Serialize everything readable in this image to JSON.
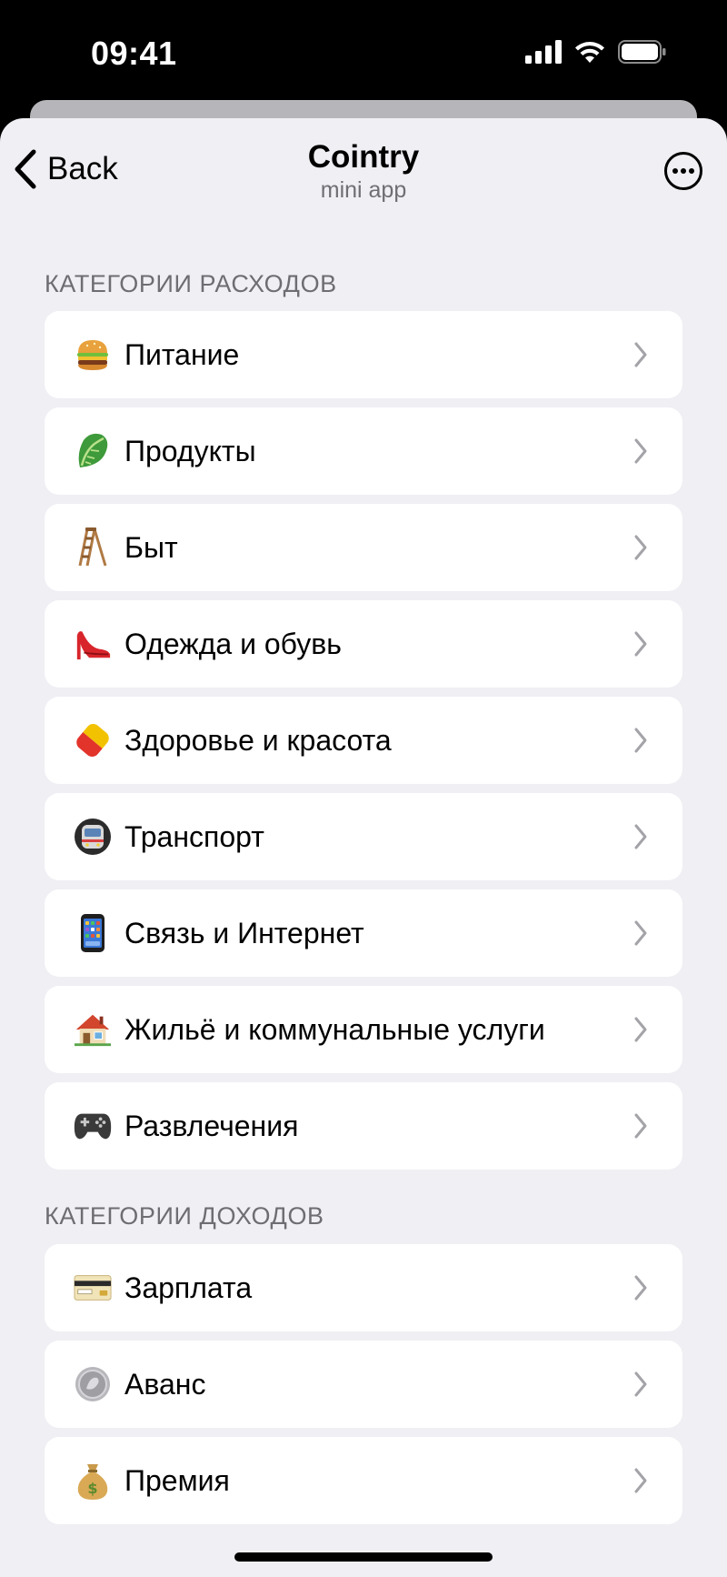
{
  "status_bar": {
    "time": "09:41"
  },
  "nav": {
    "back_label": "Back",
    "title": "Cointry",
    "subtitle": "mini app"
  },
  "expense_section": {
    "header": "КАТЕГОРИИ РАСХОДОВ",
    "items": [
      {
        "label": "Питание",
        "icon": "burger-icon"
      },
      {
        "label": "Продукты",
        "icon": "lettuce-icon"
      },
      {
        "label": "Быт",
        "icon": "ladder-icon"
      },
      {
        "label": "Одежда и обувь",
        "icon": "high-heel-icon"
      },
      {
        "label": "Здоровье и красота",
        "icon": "pill-icon"
      },
      {
        "label": "Транспорт",
        "icon": "metro-icon"
      },
      {
        "label": "Связь и Интернет",
        "icon": "phone-icon"
      },
      {
        "label": "Жильё и коммунальные услуги",
        "icon": "house-icon"
      },
      {
        "label": "Развлечения",
        "icon": "gamepad-icon"
      }
    ]
  },
  "income_section": {
    "header": "КАТЕГОРИИ ДОХОДОВ",
    "items": [
      {
        "label": "Зарплата",
        "icon": "credit-card-icon"
      },
      {
        "label": "Аванс",
        "icon": "coin-icon"
      },
      {
        "label": "Премия",
        "icon": "money-bag-icon"
      }
    ]
  },
  "colors": {
    "background": "#efeff4",
    "row": "#ffffff",
    "section_header": "#6d6d72",
    "chevron": "#a3a3a8"
  }
}
